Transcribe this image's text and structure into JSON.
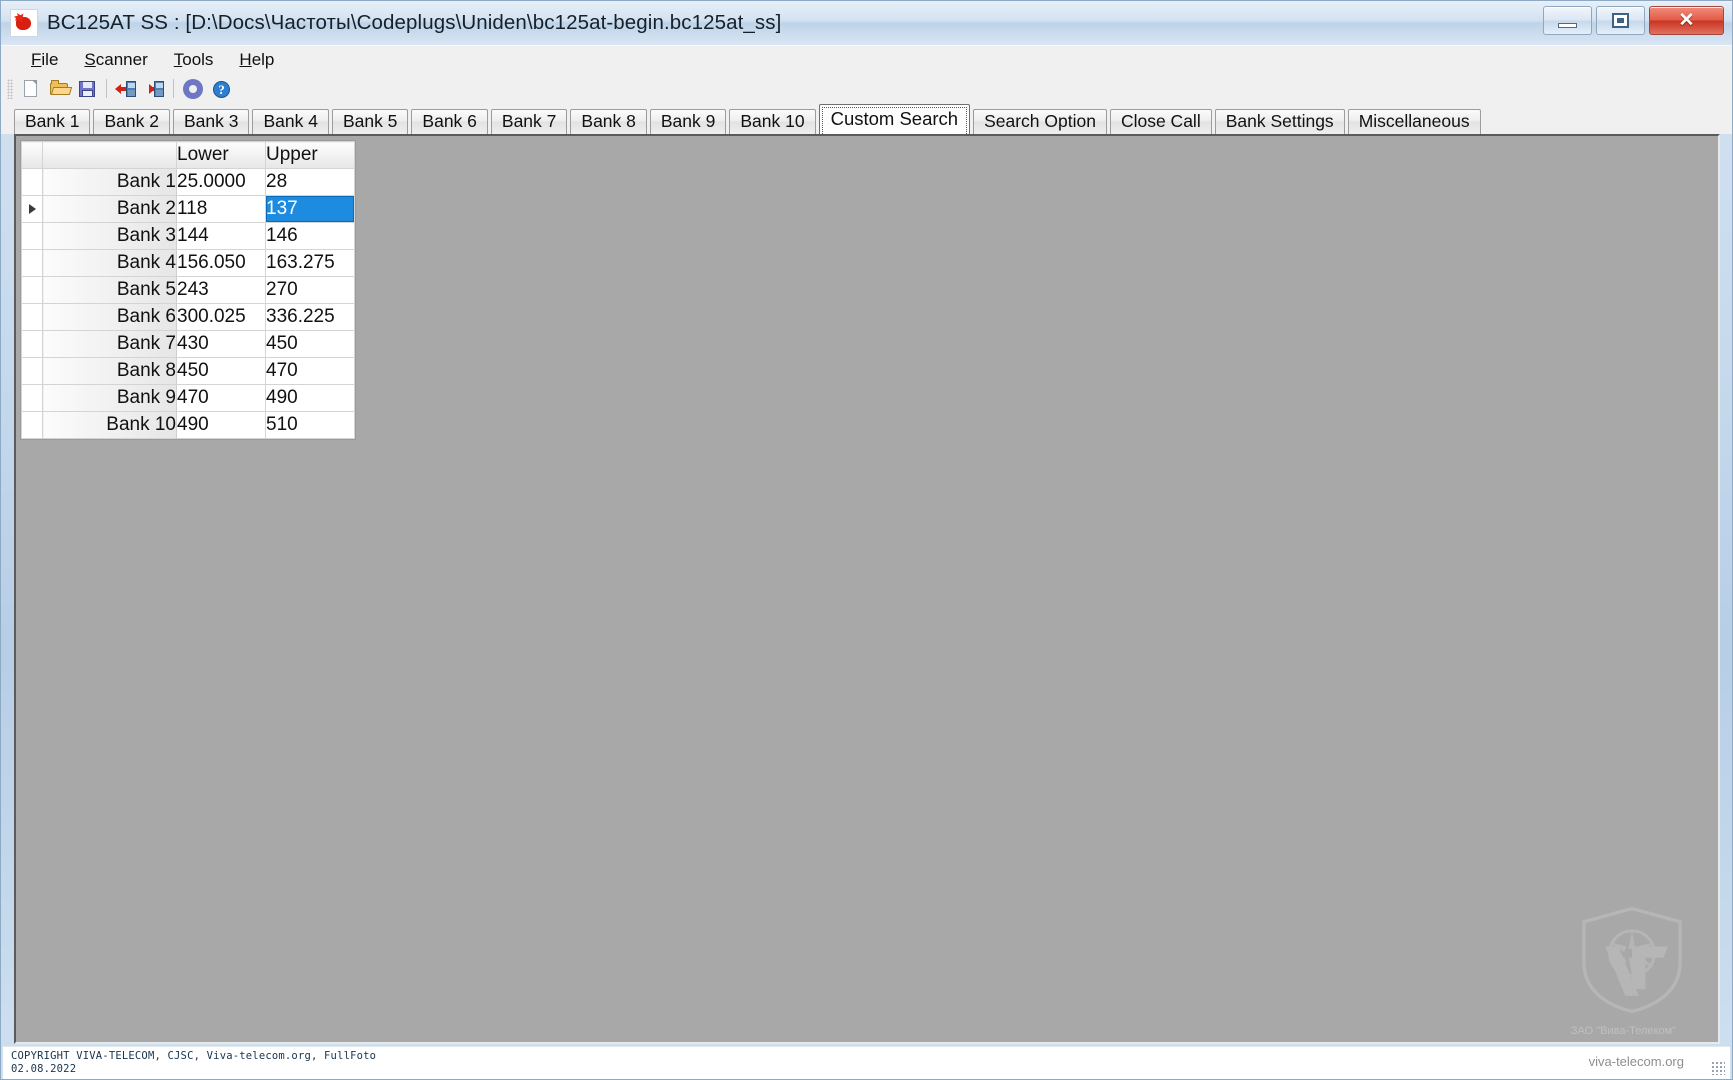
{
  "window": {
    "title": "BC125AT SS : [D:\\Docs\\Частоты\\Codeplugs\\Uniden\\bc125at-begin.bc125at_ss]",
    "icon": "scanner-app-icon",
    "buttons": {
      "minimize": "minimize-button",
      "maximize": "maximize-button",
      "close": "✕"
    }
  },
  "menubar": [
    {
      "label": "File",
      "accel": "F",
      "rest": "ile"
    },
    {
      "label": "Scanner",
      "accel": "S",
      "rest": "canner"
    },
    {
      "label": "Tools",
      "accel": "T",
      "rest": "ools"
    },
    {
      "label": "Help",
      "accel": "H",
      "rest": "elp"
    }
  ],
  "toolbar": [
    {
      "name": "new-file-button",
      "icon": "new-document-icon"
    },
    {
      "name": "open-file-button",
      "icon": "open-folder-icon"
    },
    {
      "name": "save-file-button",
      "icon": "save-floppy-icon"
    },
    {
      "name": "read-from-scanner-button",
      "icon": "arrow-left-scanner-icon"
    },
    {
      "name": "write-to-scanner-button",
      "icon": "arrow-right-scanner-icon"
    },
    {
      "name": "settings-button",
      "icon": "gear-icon"
    },
    {
      "name": "help-button",
      "icon": "question-mark-icon",
      "glyph": "?"
    }
  ],
  "tabs": [
    {
      "label": "Bank 1",
      "selected": false
    },
    {
      "label": "Bank 2",
      "selected": false
    },
    {
      "label": "Bank 3",
      "selected": false
    },
    {
      "label": "Bank 4",
      "selected": false
    },
    {
      "label": "Bank 5",
      "selected": false
    },
    {
      "label": "Bank 6",
      "selected": false
    },
    {
      "label": "Bank 7",
      "selected": false
    },
    {
      "label": "Bank 8",
      "selected": false
    },
    {
      "label": "Bank 9",
      "selected": false
    },
    {
      "label": "Bank 10",
      "selected": false
    },
    {
      "label": "Custom Search",
      "selected": true
    },
    {
      "label": "Search Option",
      "selected": false
    },
    {
      "label": "Close Call",
      "selected": false
    },
    {
      "label": "Bank Settings",
      "selected": false
    },
    {
      "label": "Miscellaneous",
      "selected": false
    }
  ],
  "grid": {
    "columns": [
      "",
      "Lower",
      "Upper"
    ],
    "current_row_index": 1,
    "selected_cell": {
      "row": 1,
      "column": "Upper",
      "value": "137"
    },
    "rows": [
      {
        "header": "Bank 1",
        "lower": "25.0000",
        "upper": "28"
      },
      {
        "header": "Bank 2",
        "lower": "118",
        "upper": "137"
      },
      {
        "header": "Bank 3",
        "lower": "144",
        "upper": "146"
      },
      {
        "header": "Bank 4",
        "lower": "156.050",
        "upper": "163.275"
      },
      {
        "header": "Bank 5",
        "lower": "243",
        "upper": "270"
      },
      {
        "header": "Bank 6",
        "lower": "300.025",
        "upper": "336.225"
      },
      {
        "header": "Bank 7",
        "lower": "430",
        "upper": "450"
      },
      {
        "header": "Bank 8",
        "lower": "450",
        "upper": "470"
      },
      {
        "header": "Bank 9",
        "lower": "470",
        "upper": "490"
      },
      {
        "header": "Bank 10",
        "lower": "490",
        "upper": "510"
      }
    ]
  },
  "watermarks": {
    "copyright_line1": "COPYRIGHT VIVA-TELECOM, CJSC, Viva-telecom.org, FullFoto",
    "copyright_line2": "02.08.2022",
    "logo_company": "ЗАО \"Вива-Телеком\"",
    "logo_url": "viva-telecom.org"
  },
  "colors": {
    "selection_blue": "#1d8ce0",
    "client_gray": "#a8a8a8",
    "close_red": "#c93523"
  }
}
